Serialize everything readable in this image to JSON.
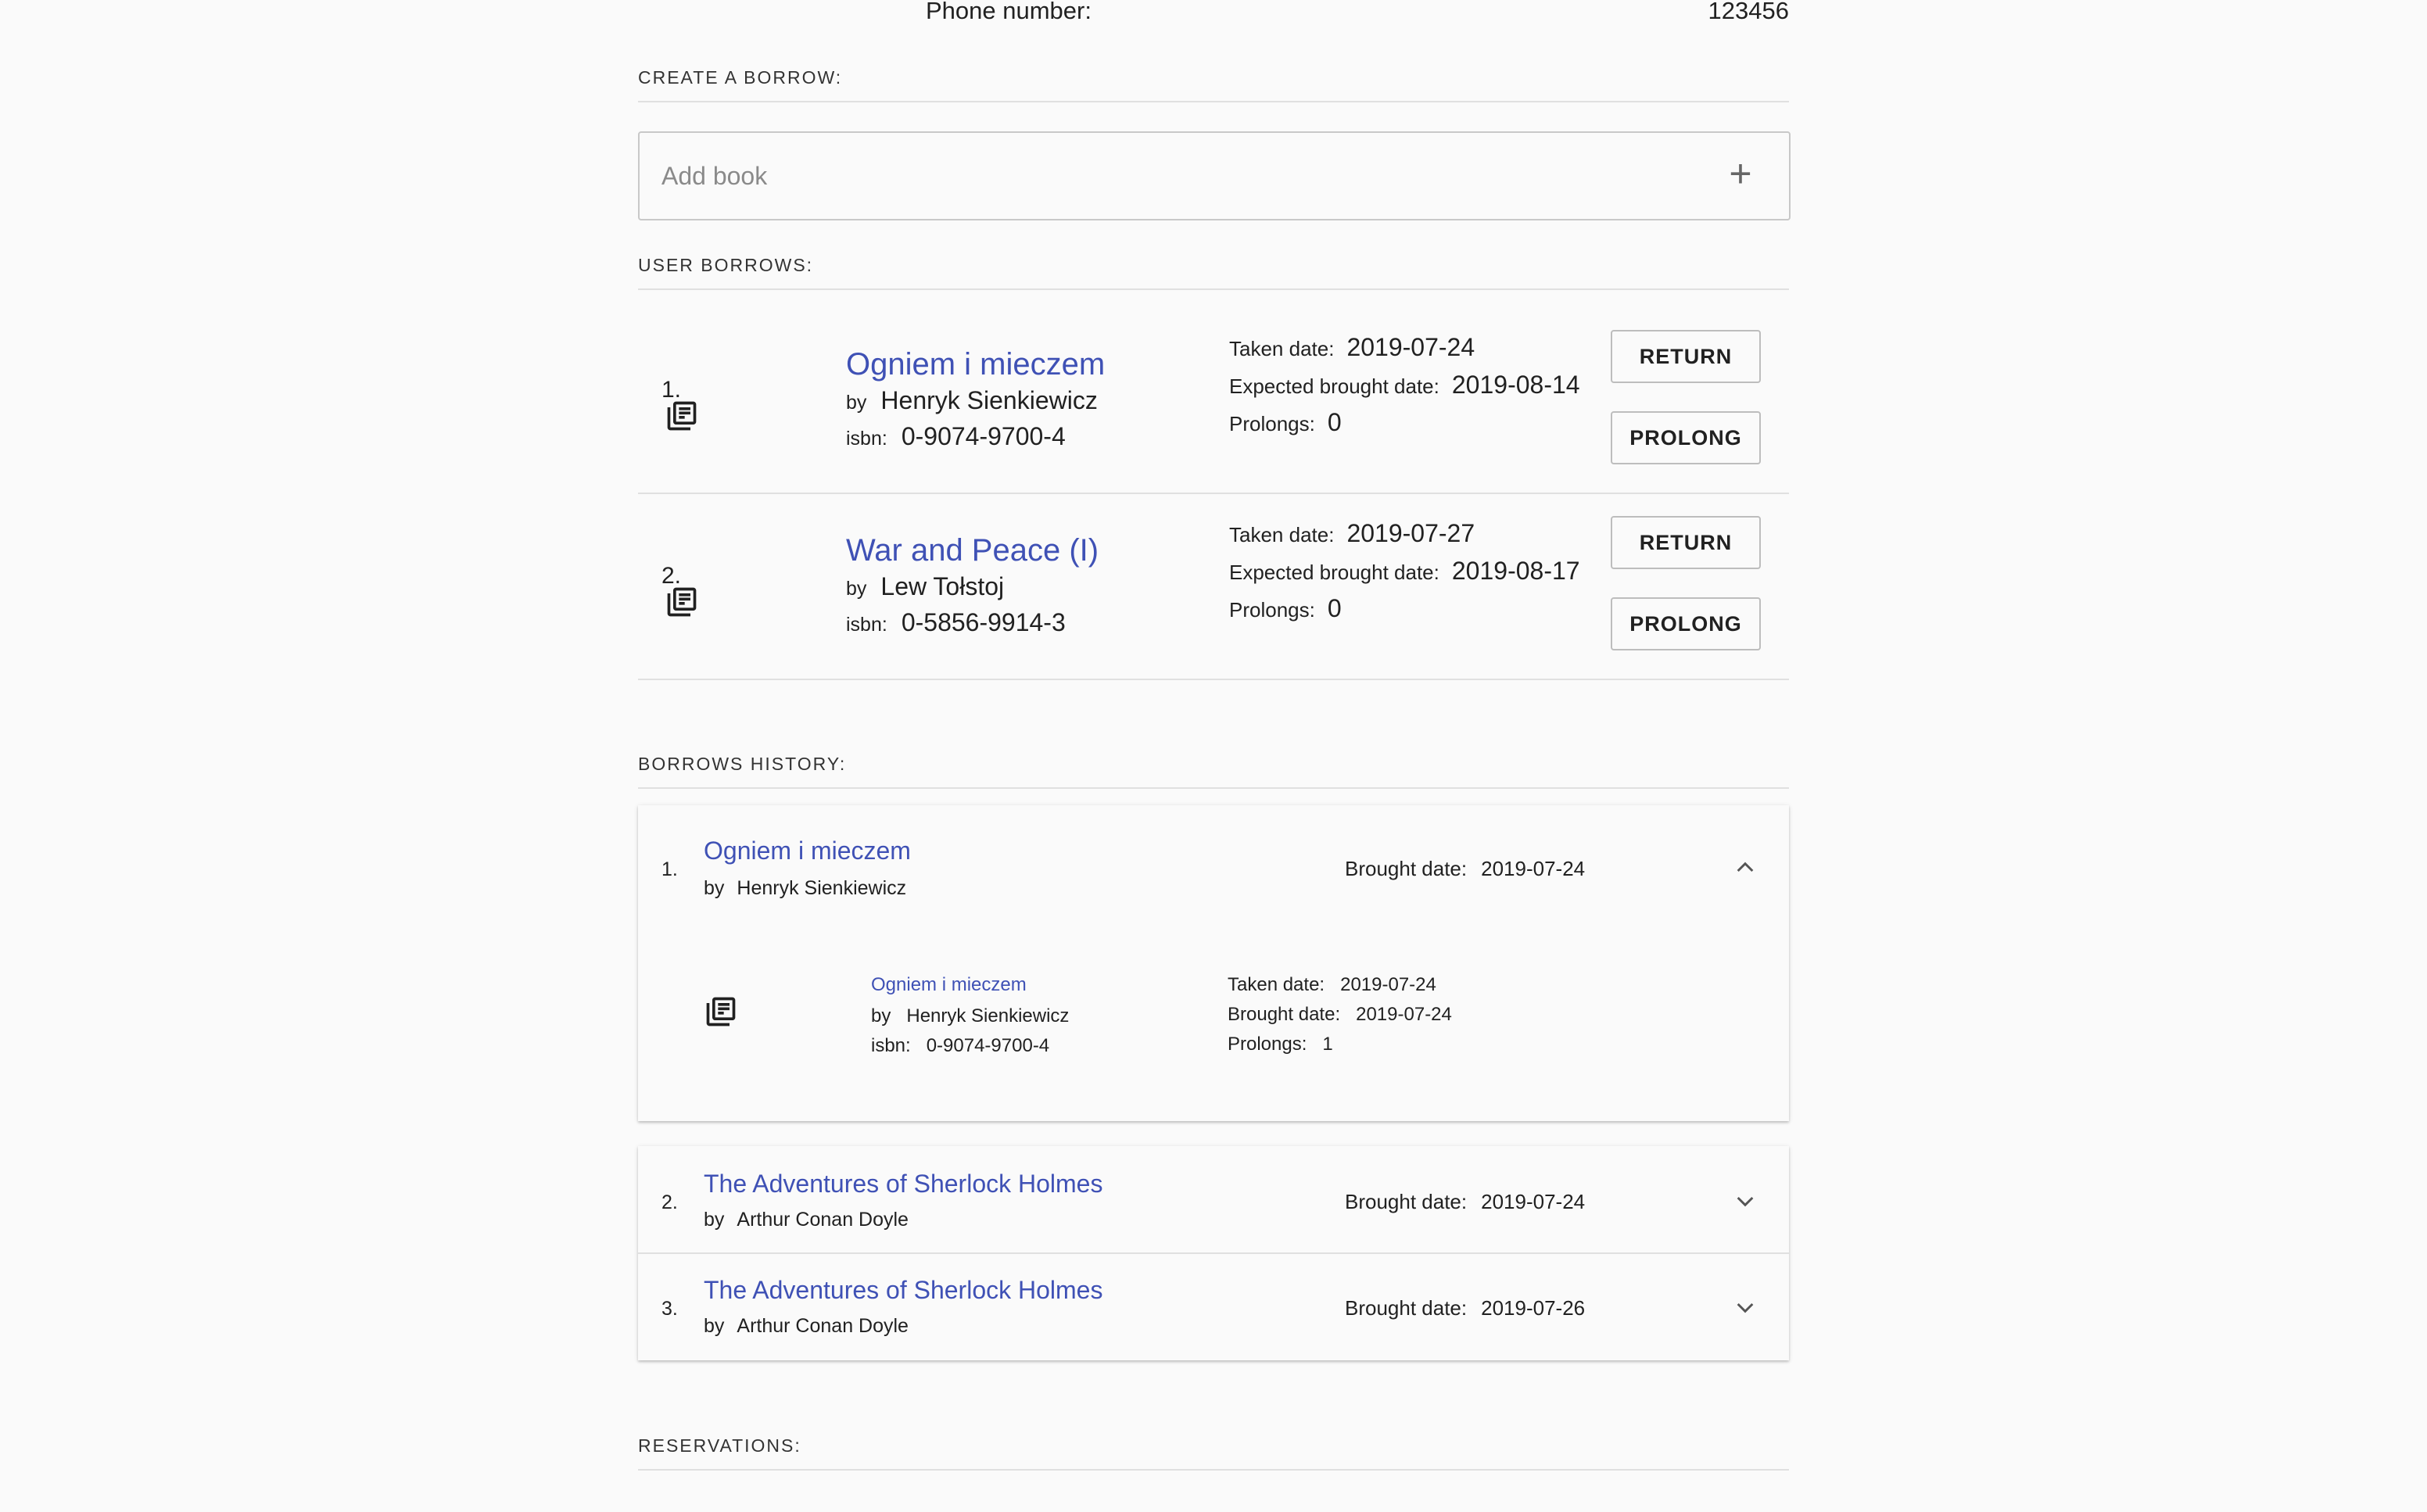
{
  "profile": {
    "phone_label": "Phone number:",
    "phone_value": "123456"
  },
  "create_borrow": {
    "title": "CREATE A BORROW:",
    "placeholder": "Add book",
    "add_icon": "plus-icon"
  },
  "user_borrows": {
    "title": "USER BORROWS:",
    "labels": {
      "by": "by",
      "isbn": "isbn:",
      "taken": "Taken date:",
      "expected": "Expected brought date:",
      "prolongs": "Prolongs:",
      "return": "RETURN",
      "prolong": "PROLONG"
    },
    "items": [
      {
        "index": "1.",
        "title": "Ogniem i mieczem",
        "author": "Henryk Sienkiewicz",
        "isbn": "0-9074-9700-4",
        "taken_date": "2019-07-24",
        "expected_date": "2019-08-14",
        "prolongs": "0"
      },
      {
        "index": "2.",
        "title": "War and Peace (I)",
        "author": "Lew Tołstoj",
        "isbn": "0-5856-9914-3",
        "taken_date": "2019-07-27",
        "expected_date": "2019-08-17",
        "prolongs": "0"
      }
    ]
  },
  "history": {
    "title": "BORROWS HISTORY:",
    "labels": {
      "by": "by",
      "brought": "Brought date:",
      "isbn": "isbn:",
      "taken": "Taken date:",
      "prolongs": "Prolongs:"
    },
    "items": [
      {
        "index": "1.",
        "title": "Ogniem i mieczem",
        "author": "Henryk Sienkiewicz",
        "brought_date": "2019-07-24",
        "expanded": true,
        "detail": {
          "title": "Ogniem i mieczem",
          "author": "Henryk Sienkiewicz",
          "isbn": "0-9074-9700-4",
          "taken_date": "2019-07-24",
          "brought_date": "2019-07-24",
          "prolongs": "1"
        }
      },
      {
        "index": "2.",
        "title": "The Adventures of Sherlock Holmes",
        "author": "Arthur Conan Doyle",
        "brought_date": "2019-07-24",
        "expanded": false
      },
      {
        "index": "3.",
        "title": "The Adventures of Sherlock Holmes",
        "author": "Arthur Conan Doyle",
        "brought_date": "2019-07-26",
        "expanded": false
      }
    ]
  },
  "reservations": {
    "title": "RESERVATIONS:"
  },
  "icons": {
    "book": "library-books-icon",
    "expand_less": "chevron-up-icon",
    "expand_more": "chevron-down-icon"
  },
  "colors": {
    "link": "#3f51b5",
    "background": "#fafafa",
    "divider": "#e0e0e0"
  }
}
